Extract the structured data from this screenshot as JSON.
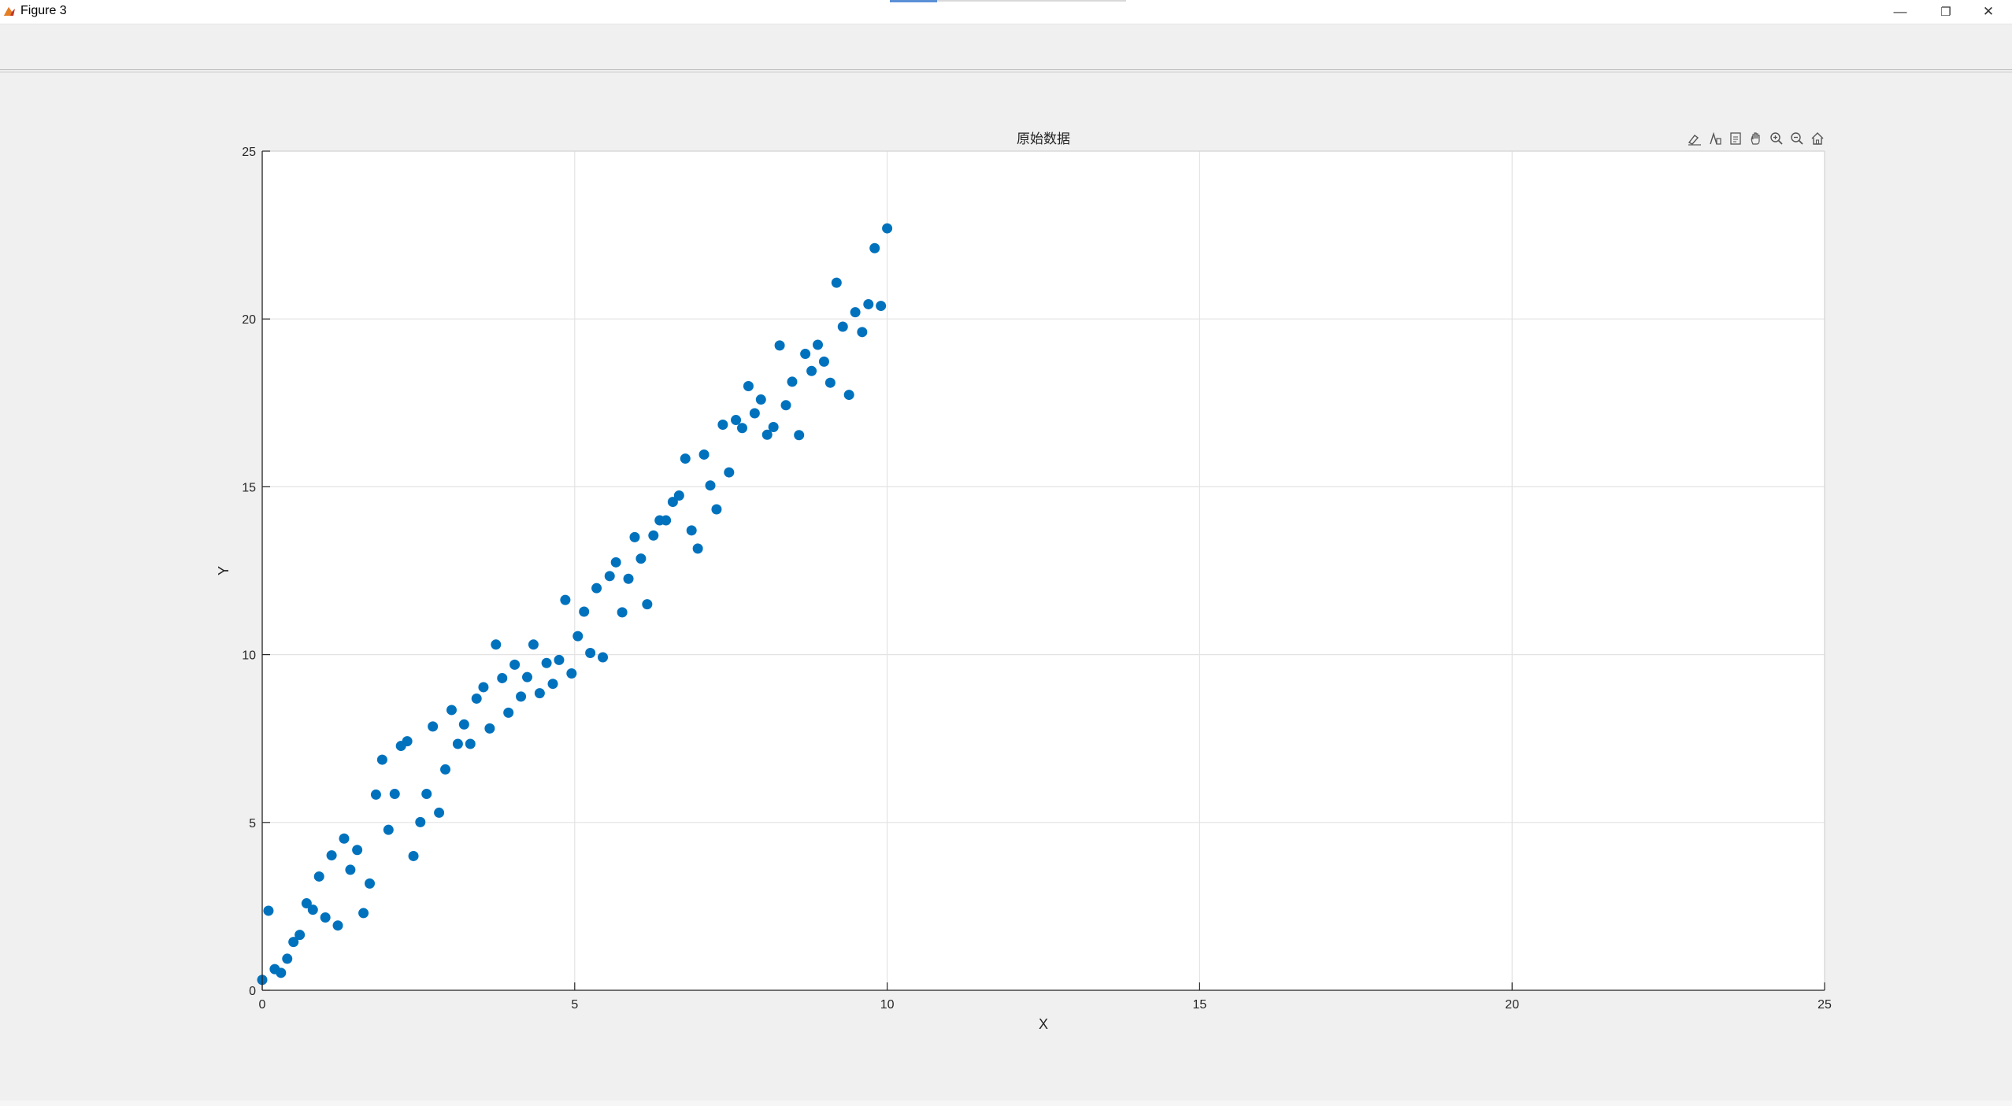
{
  "window": {
    "title": "Figure 3",
    "controls": {
      "minimize": "—",
      "restore": "❐",
      "close": "✕"
    }
  },
  "axes_toolbar": {
    "icons": [
      "brush-icon",
      "data-tips-icon",
      "export-icon",
      "pan-icon",
      "zoom-in-icon",
      "zoom-out-icon",
      "home-icon"
    ]
  },
  "colors": {
    "marker": "#0072bd",
    "grid": "#e3e3e3",
    "axis": "#262626",
    "figure_bg": "#f0f0f0",
    "axes_bg": "#ffffff"
  },
  "chart_data": {
    "type": "scatter",
    "title": "原始数据",
    "xlabel": "X",
    "ylabel": "Y",
    "xlim": [
      0,
      25
    ],
    "ylim": [
      0,
      25
    ],
    "xticks": [
      0,
      5,
      10,
      15,
      20,
      25
    ],
    "yticks": [
      0,
      5,
      10,
      15,
      20,
      25
    ],
    "grid": true,
    "marker": "filled-circle",
    "points": [
      [
        0.0,
        0.31
      ],
      [
        0.1,
        2.37
      ],
      [
        0.2,
        0.63
      ],
      [
        0.3,
        0.52
      ],
      [
        0.4,
        0.94
      ],
      [
        0.5,
        1.44
      ],
      [
        0.6,
        1.65
      ],
      [
        0.71,
        2.59
      ],
      [
        0.81,
        2.4
      ],
      [
        0.91,
        3.39
      ],
      [
        1.01,
        2.17
      ],
      [
        1.11,
        4.02
      ],
      [
        1.21,
        1.93
      ],
      [
        1.31,
        4.52
      ],
      [
        1.41,
        3.59
      ],
      [
        1.52,
        4.18
      ],
      [
        1.62,
        2.3
      ],
      [
        1.72,
        3.18
      ],
      [
        1.82,
        5.83
      ],
      [
        1.92,
        6.87
      ],
      [
        2.02,
        4.78
      ],
      [
        2.12,
        5.85
      ],
      [
        2.22,
        7.28
      ],
      [
        2.32,
        7.42
      ],
      [
        2.42,
        4.0
      ],
      [
        2.53,
        5.01
      ],
      [
        2.63,
        5.85
      ],
      [
        2.73,
        7.86
      ],
      [
        2.83,
        5.29
      ],
      [
        2.93,
        6.58
      ],
      [
        3.03,
        8.35
      ],
      [
        3.13,
        7.34
      ],
      [
        3.23,
        7.92
      ],
      [
        3.33,
        7.34
      ],
      [
        3.43,
        8.69
      ],
      [
        3.54,
        9.03
      ],
      [
        3.64,
        7.8
      ],
      [
        3.74,
        10.3
      ],
      [
        3.84,
        9.3
      ],
      [
        3.94,
        8.27
      ],
      [
        4.04,
        9.7
      ],
      [
        4.14,
        8.75
      ],
      [
        4.24,
        9.33
      ],
      [
        4.34,
        10.3
      ],
      [
        4.44,
        8.85
      ],
      [
        4.55,
        9.75
      ],
      [
        4.65,
        9.13
      ],
      [
        4.75,
        9.84
      ],
      [
        4.85,
        11.63
      ],
      [
        4.95,
        9.44
      ],
      [
        5.05,
        10.55
      ],
      [
        5.15,
        11.28
      ],
      [
        5.25,
        10.05
      ],
      [
        5.35,
        11.98
      ],
      [
        5.45,
        9.92
      ],
      [
        5.56,
        12.34
      ],
      [
        5.66,
        12.75
      ],
      [
        5.76,
        11.26
      ],
      [
        5.86,
        12.26
      ],
      [
        5.96,
        13.5
      ],
      [
        6.06,
        12.86
      ],
      [
        6.16,
        11.5
      ],
      [
        6.26,
        13.55
      ],
      [
        6.36,
        14.0
      ],
      [
        6.46,
        14.0
      ],
      [
        6.57,
        14.55
      ],
      [
        6.67,
        14.74
      ],
      [
        6.77,
        15.84
      ],
      [
        6.87,
        13.7
      ],
      [
        6.97,
        13.16
      ],
      [
        7.07,
        15.96
      ],
      [
        7.17,
        15.04
      ],
      [
        7.27,
        14.33
      ],
      [
        7.37,
        16.85
      ],
      [
        7.47,
        15.43
      ],
      [
        7.58,
        16.99
      ],
      [
        7.68,
        16.75
      ],
      [
        7.78,
        18.0
      ],
      [
        7.88,
        17.19
      ],
      [
        7.98,
        17.6
      ],
      [
        8.08,
        16.55
      ],
      [
        8.18,
        16.78
      ],
      [
        8.28,
        19.21
      ],
      [
        8.38,
        17.43
      ],
      [
        8.48,
        18.13
      ],
      [
        8.59,
        16.54
      ],
      [
        8.69,
        18.96
      ],
      [
        8.79,
        18.45
      ],
      [
        8.89,
        19.23
      ],
      [
        8.99,
        18.73
      ],
      [
        9.09,
        18.1
      ],
      [
        9.19,
        21.08
      ],
      [
        9.29,
        19.77
      ],
      [
        9.39,
        17.74
      ],
      [
        9.49,
        20.2
      ],
      [
        9.6,
        19.61
      ],
      [
        9.7,
        20.44
      ],
      [
        9.8,
        22.11
      ],
      [
        9.9,
        20.39
      ],
      [
        10.0,
        22.7
      ]
    ]
  }
}
